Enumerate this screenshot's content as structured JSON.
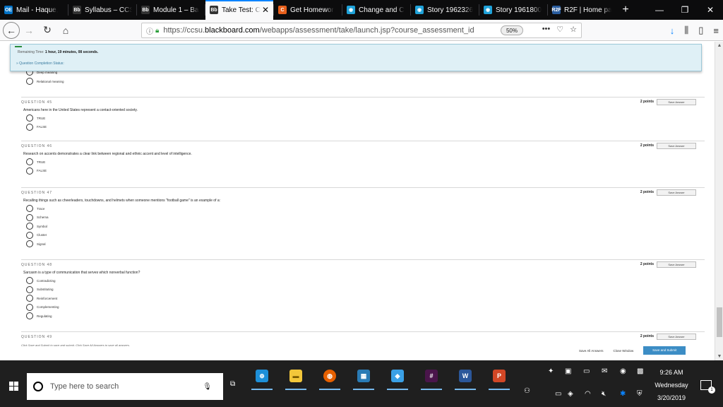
{
  "browser": {
    "tabs": [
      {
        "label": "Mail - Haque,",
        "icon": "OE",
        "icon_bg": "#0072c6"
      },
      {
        "label": "Syllabus – CCS",
        "icon": "Bb",
        "icon_bg": "#333"
      },
      {
        "label": "Module 1 – Ba",
        "icon": "Bb",
        "icon_bg": "#333"
      },
      {
        "label": "Take Test: C",
        "icon": "Bb",
        "icon_bg": "#333",
        "active": true
      },
      {
        "label": "Get Homewor",
        "icon": "C",
        "icon_bg": "#e8601c"
      },
      {
        "label": "Change and C",
        "icon": "◉",
        "icon_bg": "#1fa2d9"
      },
      {
        "label": "Story 1962326",
        "icon": "◉",
        "icon_bg": "#1fa2d9"
      },
      {
        "label": "Story 1961800",
        "icon": "◉",
        "icon_bg": "#1fa2d9"
      },
      {
        "label": "R2F | Home pa",
        "icon": "R2F",
        "icon_bg": "#2a5d9f"
      }
    ],
    "new_tab": "+",
    "url_prefix": "https://ccsu.",
    "url_domain": "blackboard.com",
    "url_rest": "/webapps/assessment/take/launch.jsp?course_assessment_id",
    "zoom": "50%"
  },
  "timer": {
    "label": "Remaining Time:",
    "value": "1 hour, 19 minutes, 08 seconds.",
    "status": "» Question Completion Status:"
  },
  "prev_options": [
    "Deep meaning",
    "Relational meaning"
  ],
  "questions": [
    {
      "num": "QUESTION 45",
      "points": "2 points",
      "save": "Save Answer",
      "prompt": "Americans here in the United States represent a contact-oriented society.",
      "options": [
        "TRUE",
        "FALSE"
      ]
    },
    {
      "num": "QUESTION 46",
      "points": "2 points",
      "save": "Save Answer",
      "prompt": "Research on accents demonstrates a clear link between regional and ethnic accent and level of intelligence.",
      "options": [
        "TRUE",
        "FALSE"
      ]
    },
    {
      "num": "QUESTION 47",
      "points": "2 points",
      "save": "Save Answer",
      "prompt": "Recalling things such as cheerleaders, touchdowns, and helmets when someone mentions \"football game\" is an example of a:",
      "options": [
        "Trace",
        "Schema",
        "Symbol",
        "Cluster",
        "Signal"
      ]
    },
    {
      "num": "QUESTION 48",
      "points": "2 points",
      "save": "Save Answer",
      "prompt": "Sarcasm is a type of communication that serves which nonverbal function?",
      "options": [
        "Contradicting",
        "Substituting",
        "Reinforcement",
        "Complementing",
        "Regulating"
      ]
    },
    {
      "num": "QUESTION 49",
      "points": "2 points",
      "save": "Save Answer"
    }
  ],
  "footer": {
    "note": "Click Save and Submit to save and submit. Click Save All Answers to save all answers.",
    "save_all": "Save All Answers",
    "close_window": "Close Window",
    "submit": "Save and Submit"
  },
  "taskbar": {
    "search_placeholder": "Type here to search",
    "time": "9:26 AM",
    "day": "Wednesday",
    "date": "3/20/2019",
    "notifications": "1"
  }
}
